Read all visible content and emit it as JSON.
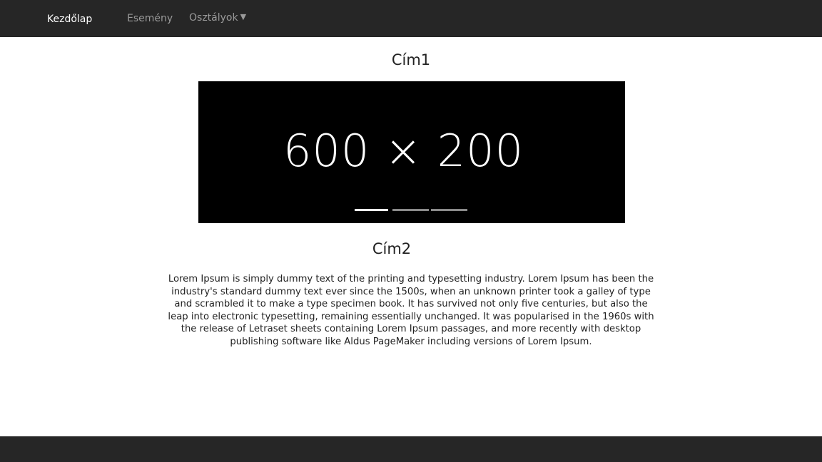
{
  "nav": {
    "brand": "Kezdőlap",
    "items": [
      {
        "label": "Esemény"
      },
      {
        "label": "Osztályok",
        "caret": "▼"
      }
    ]
  },
  "main": {
    "title1": "Cím1",
    "carousel": {
      "slide_label": "600 × 200",
      "indicator_count": 3,
      "active_index": 0
    },
    "title2": "Cím2",
    "body": "Lorem Ipsum is simply dummy text of the printing and typesetting industry. Lorem Ipsum has been the industry's standard dummy text ever since the 1500s, when an unknown printer took a galley of type and scrambled it to make a type specimen book. It has survived not only five centuries, but also the leap into electronic typesetting, remaining essentially unchanged. It was popularised in the 1960s with the release of Letraset sheets containing Lorem Ipsum passages, and more recently with desktop publishing software like Aldus PageMaker including versions of Lorem Ipsum."
  },
  "colors": {
    "navbar_bg": "#262626",
    "nav_text_active": "#ffffff",
    "nav_text_muted": "#9a9a9a",
    "carousel_bg": "#000000",
    "indicator_active": "#ffffff",
    "indicator_inactive": "#8a8a8a"
  }
}
